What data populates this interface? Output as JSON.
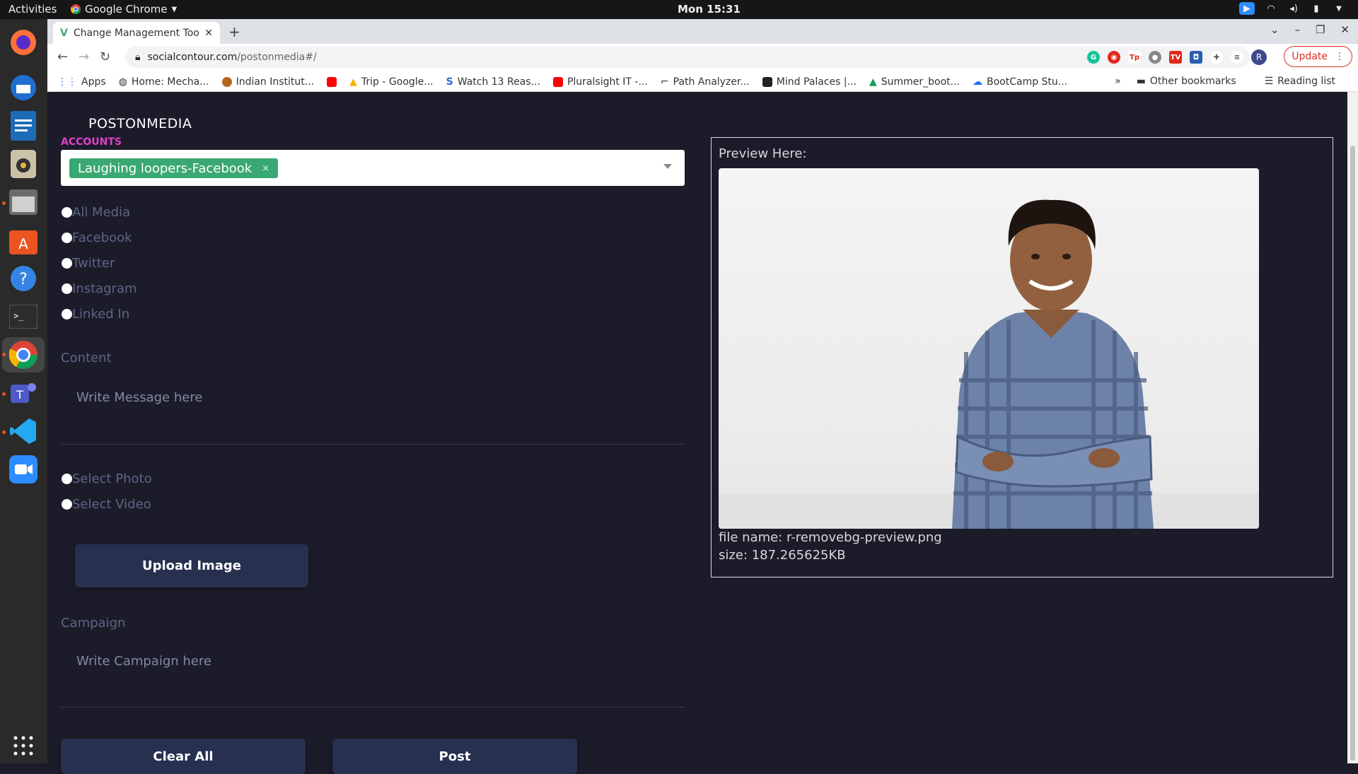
{
  "os": {
    "activities": "Activities",
    "app_name": "Google Chrome",
    "clock": "Mon 15:31"
  },
  "browser": {
    "tab_title": "Change Management Too",
    "url_host": "socialcontour.com",
    "url_path": "/postonmedia#/",
    "update_label": "Update",
    "profile_initial": "R",
    "bookmarks": [
      "Apps",
      "Home: Mecha...",
      "Indian Institut...",
      "",
      "Trip - Google...",
      "Watch 13 Reas...",
      "Pluralsight IT -...",
      "Path Analyzer...",
      "Mind Palaces |...",
      "Summer_boot...",
      "BootCamp Stu..."
    ],
    "other_bookmarks": "Other bookmarks",
    "reading_list": "Reading list"
  },
  "page": {
    "brand": "POSTONMEDIA",
    "accounts_label": "ACCOUNTS",
    "selected_account": "Laughing loopers-Facebook",
    "chip_remove": "×",
    "media_options": [
      "All Media",
      "Facebook",
      "Twitter",
      "Instagram",
      "Linked In"
    ],
    "content_label": "Content",
    "content_placeholder": "Write Message here",
    "upload_options": [
      "Select Photo",
      "Select Video"
    ],
    "upload_button": "Upload Image",
    "campaign_label": "Campaign",
    "campaign_placeholder": "Write Campaign here",
    "clear_button": "Clear All",
    "post_button": "Post",
    "preview_title": "Preview Here:",
    "file_name": "file name: r-removebg-preview.png",
    "file_size": "size: 187.265625KB"
  },
  "colors": {
    "page_bg": "#1c1b2a",
    "accent_pink": "#e040c8",
    "chip_green": "#3aa872",
    "button_bg": "#27304f",
    "muted_text": "#5d6685"
  }
}
